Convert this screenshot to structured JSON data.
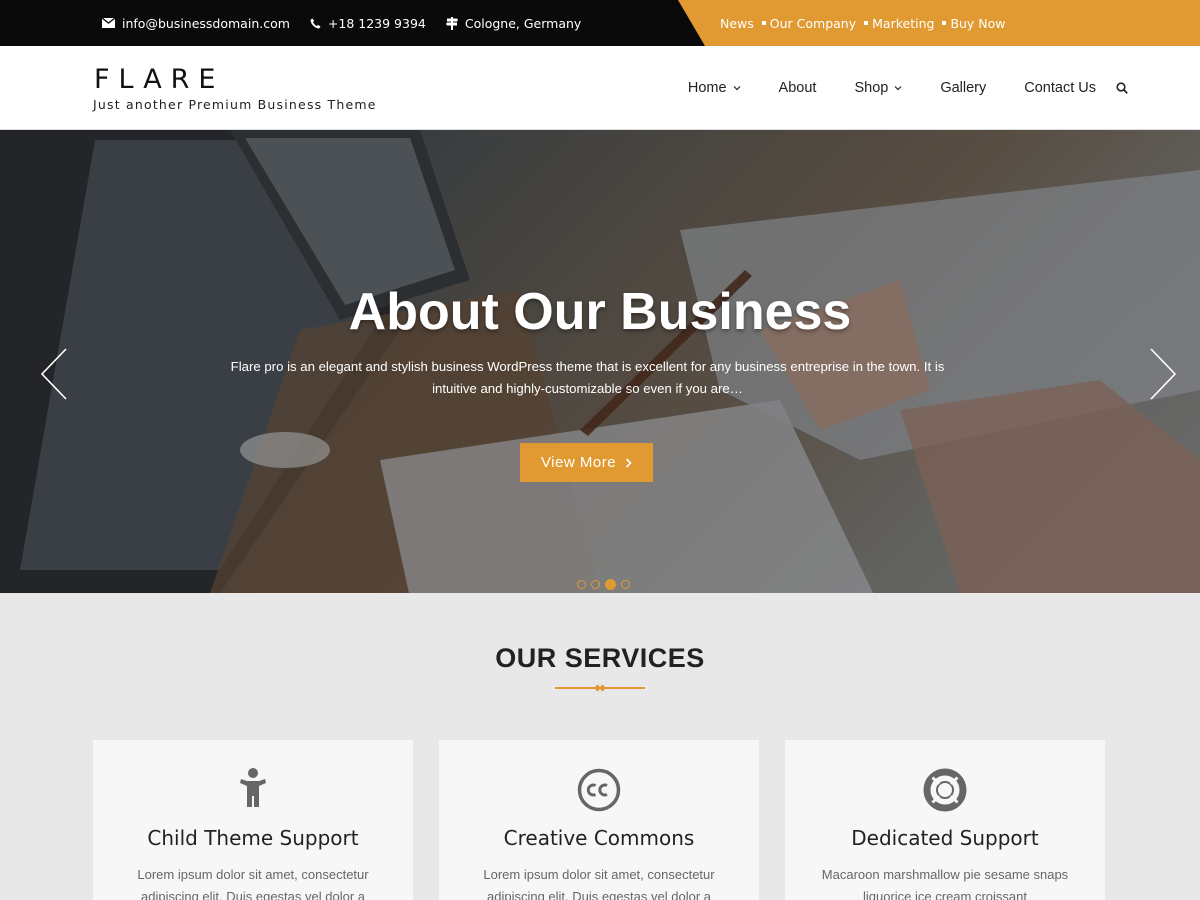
{
  "topbar": {
    "email": "info@businessdomain.com",
    "phone": "+18 1239 9394",
    "location": "Cologne, Germany",
    "links": [
      "News",
      "Our Company",
      "Marketing",
      "Buy Now"
    ],
    "accent_color": "#e19a31"
  },
  "header": {
    "logo": "FLARE",
    "tagline": "Just another Premium Business Theme",
    "nav": [
      {
        "label": "Home",
        "dropdown": true
      },
      {
        "label": "About",
        "dropdown": false
      },
      {
        "label": "Shop",
        "dropdown": true
      },
      {
        "label": "Gallery",
        "dropdown": false
      },
      {
        "label": "Contact Us",
        "dropdown": false
      }
    ]
  },
  "hero": {
    "title": "About Our Business",
    "text": "Flare pro is an elegant and stylish business WordPress theme that is excellent for any business entreprise in the town. It is intuitive and highly-customizable so even if you are…",
    "button_label": "View More",
    "slide_count": 4,
    "active_slide": 3
  },
  "services": {
    "title": "OUR SERVICES",
    "items": [
      {
        "icon": "child-icon",
        "title": "Child Theme Support",
        "text": "Lorem ipsum dolor sit amet, consectetur adipiscing elit. Duis egestas vel dolor a"
      },
      {
        "icon": "creative-commons-icon",
        "title": "Creative Commons",
        "text": "Lorem ipsum dolor sit amet, consectetur adipiscing elit. Duis egestas vel dolor a"
      },
      {
        "icon": "life-ring-icon",
        "title": "Dedicated Support",
        "text": "Macaroon marshmallow pie sesame snaps liquorice ice cream croissant"
      }
    ]
  }
}
